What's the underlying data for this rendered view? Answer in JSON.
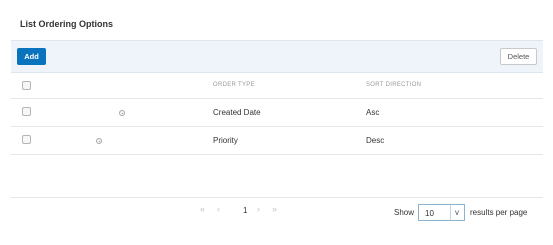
{
  "page": {
    "title": "List Ordering Options"
  },
  "toolbar": {
    "add_label": "Add",
    "delete_label": "Delete"
  },
  "table": {
    "headers": {
      "order_type": "ORDER TYPE",
      "sort_direction": "SORT DIRECTION"
    },
    "rows": [
      {
        "order_type": "Created Date",
        "sort_direction": "Asc"
      },
      {
        "order_type": "Priority",
        "sort_direction": "Desc"
      }
    ]
  },
  "pagination": {
    "first": "«",
    "prev": "‹",
    "current_page": "1",
    "next": "›",
    "last": "»",
    "show_label": "Show",
    "page_size": "10",
    "page_size_chevron": "v",
    "per_page_label": "results per page"
  }
}
